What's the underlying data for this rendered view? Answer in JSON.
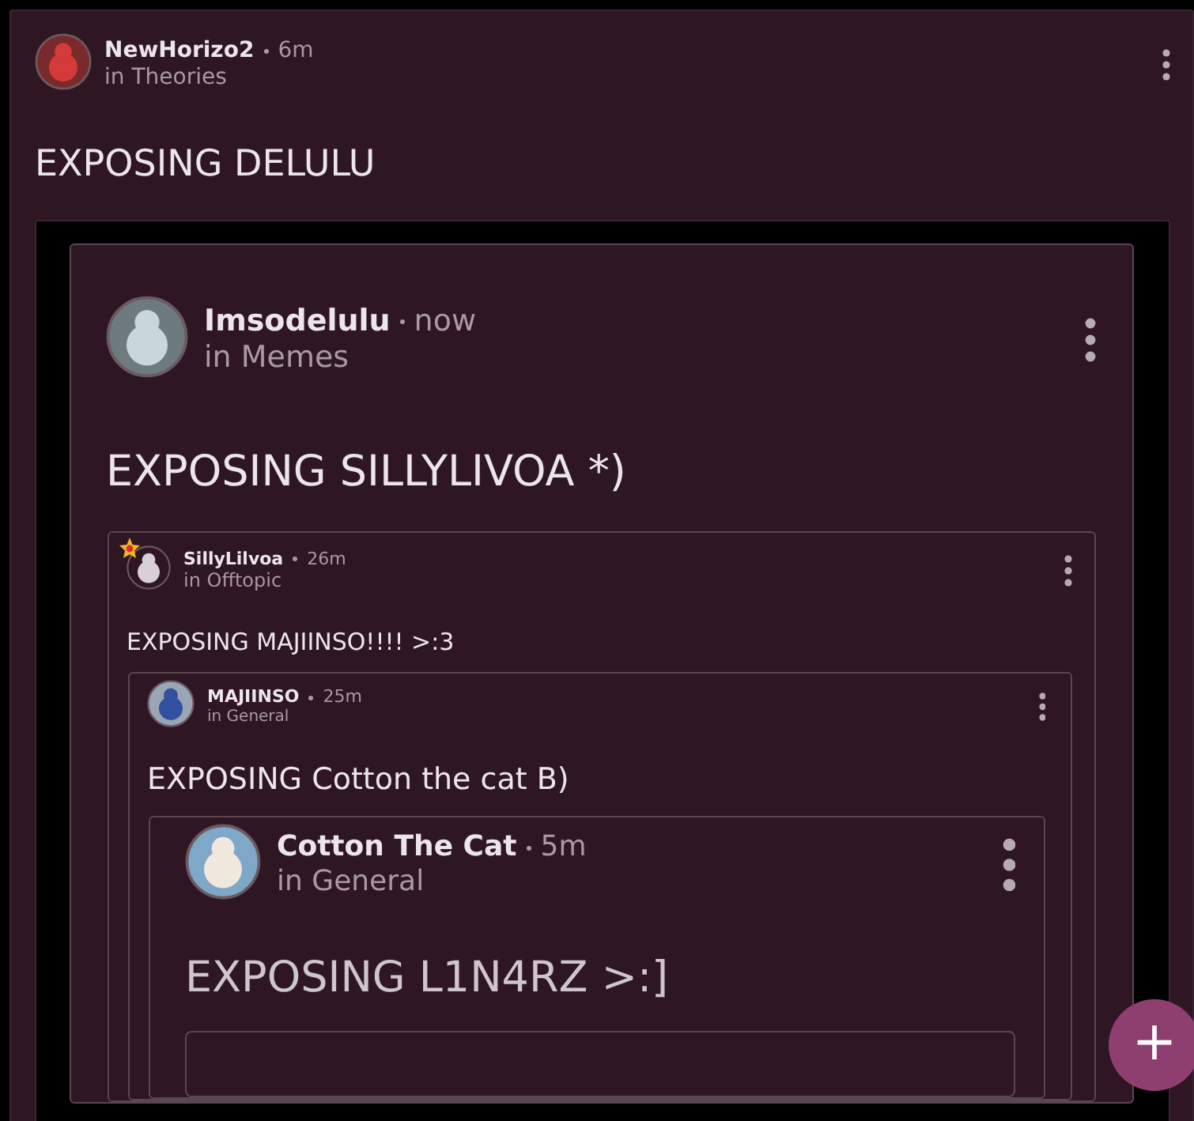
{
  "post": {
    "author": "NewHorizo2",
    "time": "6m",
    "category": "in Theories",
    "title": "EXPOSING DELULU",
    "attachment": {
      "kind": "screenshot",
      "post": {
        "author": "Imsodelulu",
        "time": "now",
        "category": "in Memes",
        "title": "EXPOSING SILLYLIVOA *)",
        "quote": {
          "author": "SillyLilvoa",
          "time": "26m",
          "category": "in Offtopic",
          "badge": true,
          "title": "EXPOSING MAJIINSO!!!! >:3",
          "quote": {
            "author": "MAJIINSO",
            "time": "25m",
            "category": "in General",
            "title": "EXPOSING Cotton the cat B)",
            "quote": {
              "author": "Cotton The Cat",
              "time": "5m",
              "category": "in General",
              "title": "EXPOSING L1N4RZ >:]",
              "quote": {
                "kind": "cut"
              }
            }
          }
        }
      }
    }
  },
  "fab": {
    "label": "+"
  }
}
